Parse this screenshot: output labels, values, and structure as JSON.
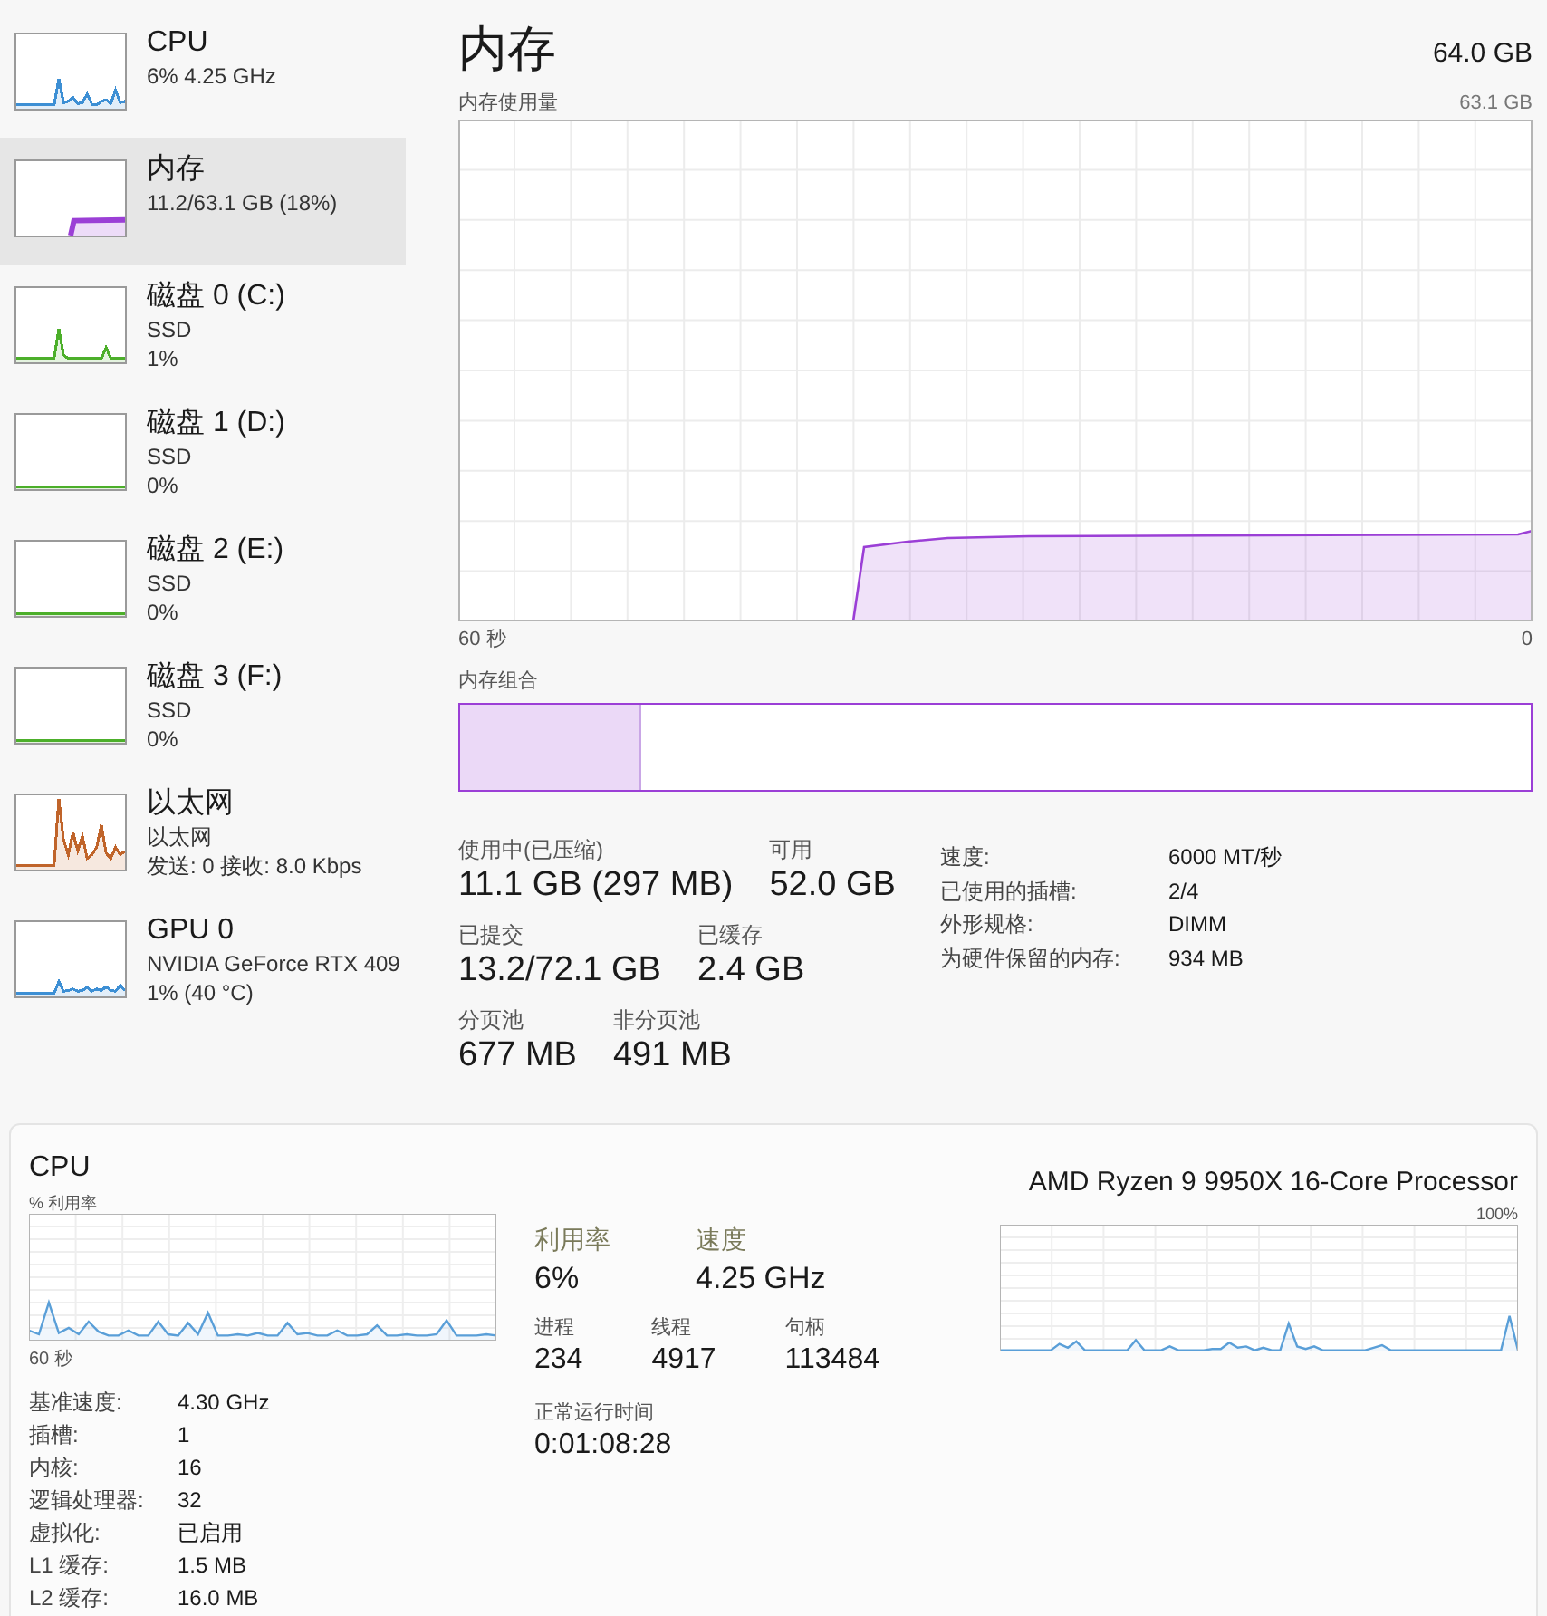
{
  "sidebar": {
    "items": [
      {
        "kind": "line",
        "title": "CPU",
        "lines": [
          "6%  4.25 GHz"
        ],
        "selected": false,
        "color": "#3d8fd4"
      },
      {
        "kind": "area",
        "title": "内存",
        "lines": [
          "11.2/63.1 GB (18%)"
        ],
        "selected": true,
        "color": "#9b3fd6"
      },
      {
        "kind": "line",
        "title": "磁盘 0 (C:)",
        "lines": [
          "SSD",
          "1%"
        ],
        "selected": false,
        "color": "#4caf2a"
      },
      {
        "kind": "line",
        "title": "磁盘 1 (D:)",
        "lines": [
          "SSD",
          "0%"
        ],
        "selected": false,
        "color": "#4caf2a"
      },
      {
        "kind": "line",
        "title": "磁盘 2 (E:)",
        "lines": [
          "SSD",
          "0%"
        ],
        "selected": false,
        "color": "#4caf2a"
      },
      {
        "kind": "line",
        "title": "磁盘 3 (F:)",
        "lines": [
          "SSD",
          "0%"
        ],
        "selected": false,
        "color": "#4caf2a"
      },
      {
        "kind": "line",
        "title": "以太网",
        "lines": [
          "以太网",
          "发送: 0 接收: 8.0 Kbps"
        ],
        "selected": false,
        "color": "#c0642a"
      },
      {
        "kind": "line",
        "title": "GPU 0",
        "lines": [
          "NVIDIA GeForce RTX 409",
          "1%  (40 °C)"
        ],
        "selected": false,
        "color": "#3d8fd4"
      }
    ]
  },
  "memory": {
    "title": "内存",
    "total": "64.0 GB",
    "usage_label": "内存使用量",
    "usage_max": "63.1 GB",
    "time_start": "60 秒",
    "time_end": "0",
    "composition_label": "内存组合",
    "composition": {
      "level": 0.17
    },
    "stats": [
      [
        {
          "label": "使用中(已压缩)",
          "value": "11.1 GB (297 MB)"
        },
        {
          "label": "可用",
          "value": "52.0 GB"
        }
      ],
      [
        {
          "label": "已提交",
          "value": "13.2/72.1 GB"
        },
        {
          "label": "已缓存",
          "value": "2.4 GB"
        }
      ],
      [
        {
          "label": "分页池",
          "value": "677 MB"
        },
        {
          "label": "非分页池",
          "value": "491 MB"
        }
      ]
    ],
    "details": [
      {
        "label": "速度:",
        "value": "6000 MT/秒"
      },
      {
        "label": "已使用的插槽:",
        "value": "2/4"
      },
      {
        "label": "外形规格:",
        "value": "DIMM"
      },
      {
        "label": "为硬件保留的内存:",
        "value": "934 MB"
      }
    ]
  },
  "cpu_panel": {
    "title": "CPU",
    "processor": "AMD Ryzen 9 9950X 16-Core Processor",
    "util_label": "% 利用率",
    "max_label": "100%",
    "time_start": "60 秒",
    "main_stats": [
      {
        "label": "利用率",
        "value": "6%"
      },
      {
        "label": "速度",
        "value": "4.25 GHz"
      }
    ],
    "counts": [
      {
        "label": "进程",
        "value": "234"
      },
      {
        "label": "线程",
        "value": "4917"
      },
      {
        "label": "句柄",
        "value": "113484"
      }
    ],
    "uptime": {
      "label": "正常运行时间",
      "value": "0:01:08:28"
    },
    "specs": [
      {
        "label": "基准速度:",
        "value": "4.30 GHz"
      },
      {
        "label": "插槽:",
        "value": "1"
      },
      {
        "label": "内核:",
        "value": "16"
      },
      {
        "label": "逻辑处理器:",
        "value": "32"
      },
      {
        "label": "虚拟化:",
        "value": "已启用"
      },
      {
        "label": "L1 缓存:",
        "value": "1.5 MB"
      },
      {
        "label": "L2 缓存:",
        "value": "16.0 MB"
      }
    ]
  }
}
